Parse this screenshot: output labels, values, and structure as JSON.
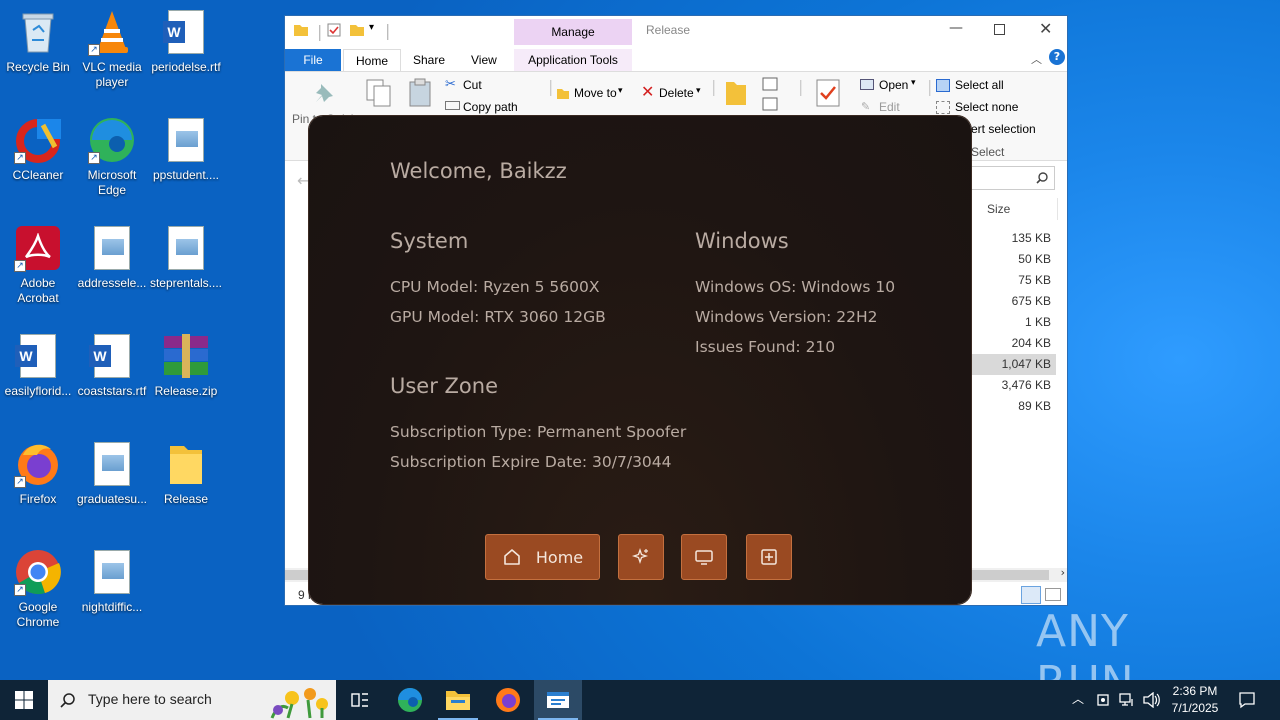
{
  "desktop": {
    "icons": [
      {
        "label": "Recycle Bin"
      },
      {
        "label": "VLC media player"
      },
      {
        "label": "periodelse.rtf"
      },
      {
        "label": "CCleaner"
      },
      {
        "label": "Microsoft Edge"
      },
      {
        "label": "ppstudent...."
      },
      {
        "label": "Adobe Acrobat"
      },
      {
        "label": "addressele..."
      },
      {
        "label": "steprentals...."
      },
      {
        "label": "easilyflorid..."
      },
      {
        "label": "coaststars.rtf"
      },
      {
        "label": "Release.zip"
      },
      {
        "label": "Firefox"
      },
      {
        "label": "graduatesu..."
      },
      {
        "label": "Release"
      },
      {
        "label": "Google Chrome"
      },
      {
        "label": "nightdiffic..."
      }
    ]
  },
  "explorer": {
    "context_tab": "Manage",
    "title": "Release",
    "tabs": {
      "file": "File",
      "home": "Home",
      "share": "Share",
      "view": "View",
      "app_tools": "Application Tools"
    },
    "ribbon": {
      "pin": "Pin to Quick",
      "cut": "Cut",
      "copy_path": "Copy path",
      "move_to": "Move to",
      "delete": "Delete",
      "open": "Open",
      "edit": "Edit",
      "select_all": "Select all",
      "select_none": "Select none",
      "invert_selection": "ert selection",
      "select_group": "Select"
    },
    "column_size": "Size",
    "sizes": [
      "135 KB",
      "50 KB",
      "75 KB",
      "675 KB",
      "1 KB",
      "204 KB",
      "1,047 KB",
      "3,476 KB",
      "89 KB"
    ],
    "status_items": "9 i"
  },
  "app": {
    "welcome": "Welcome, Baikzz",
    "system_title": "System",
    "cpu": "CPU Model: Ryzen 5 5600X",
    "gpu": "GPU Model: RTX 3060 12GB",
    "windows_title": "Windows",
    "win_os": "Windows OS: Windows 10",
    "win_ver": "Windows Version: 22H2",
    "issues": "Issues Found: 210",
    "userzone_title": "User Zone",
    "sub_type": "Subscription Type: Permanent Spoofer",
    "sub_expire": "Subscription Expire Date: 30/7/3044",
    "nav": {
      "home": "Home"
    }
  },
  "taskbar": {
    "search_placeholder": "Type here to search",
    "time": "2:36 PM",
    "date": "7/1/2025"
  },
  "watermark": "ANY RUN"
}
